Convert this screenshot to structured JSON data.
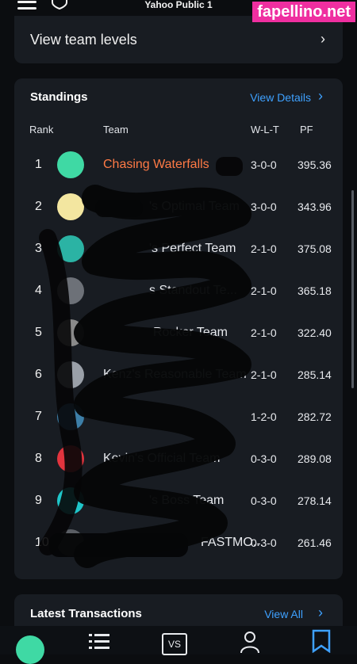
{
  "header": {
    "league_name": "Yahoo Public 1"
  },
  "watermark": "fapellino.net",
  "team_levels": {
    "label": "View team levels"
  },
  "standings": {
    "title": "Standings",
    "view_details": "View Details",
    "columns": {
      "rank": "Rank",
      "team": "Team",
      "wlt": "W-L-T",
      "pf": "PF"
    },
    "rows": [
      {
        "rank": "1",
        "team": "Chasing Waterfalls",
        "wlt": "3-0-0",
        "pf": "395.36",
        "logo_color": "#3fd9a4",
        "is_user": true
      },
      {
        "rank": "2",
        "team": "'s Optimal Team",
        "wlt": "3-0-0",
        "pf": "343.96",
        "logo_color": "#f3e6a0",
        "is_user": false
      },
      {
        "rank": "3",
        "team": "'s Perfect Team",
        "wlt": "2-1-0",
        "pf": "375.08",
        "logo_color": "#2bb3a4",
        "is_user": false
      },
      {
        "rank": "4",
        "team": "s Standout Te...",
        "wlt": "2-1-0",
        "pf": "365.18",
        "logo_color": "#6d7178",
        "is_user": false
      },
      {
        "rank": "5",
        "team": "Rocker Team",
        "wlt": "2-1-0",
        "pf": "322.40",
        "logo_color": "#8a8a8a",
        "is_user": false
      },
      {
        "rank": "6",
        "team": "Kenz's Reasonable Team",
        "wlt": "2-1-0",
        "pf": "285.14",
        "logo_color": "#9aa0a8",
        "is_user": false
      },
      {
        "rank": "7",
        "team": "",
        "wlt": "1-2-0",
        "pf": "282.72",
        "logo_color": "#3d7fa8",
        "is_user": false
      },
      {
        "rank": "8",
        "team": "Kevin's Official Team",
        "wlt": "0-3-0",
        "pf": "289.08",
        "logo_color": "#e2343e",
        "is_user": false
      },
      {
        "rank": "9",
        "team": "'s Boss Team",
        "wlt": "0-3-0",
        "pf": "278.14",
        "logo_color": "#1fc6c9",
        "is_user": false
      },
      {
        "rank": "10",
        "team": "FASTMO...",
        "wlt": "0-3-0",
        "pf": "261.46",
        "logo_color": "#5a5e64",
        "is_user": false
      }
    ]
  },
  "transactions": {
    "title": "Latest Transactions",
    "view_all": "View All"
  },
  "bottom_nav": {
    "vs_label": "VS"
  },
  "colors": {
    "accent": "#3ea1ff",
    "user_team": "#ff7a45",
    "card": "#181c22",
    "background": "#0b0d10"
  }
}
